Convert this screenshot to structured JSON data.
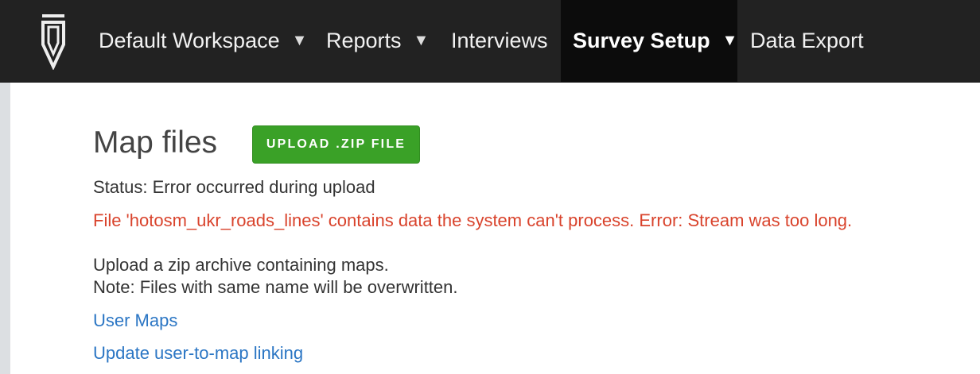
{
  "nav": {
    "items": [
      {
        "label": "Default Workspace",
        "dropdown": true
      },
      {
        "label": "Reports",
        "dropdown": true
      },
      {
        "label": "Interviews",
        "dropdown": false
      },
      {
        "label": "Survey Setup",
        "dropdown": true,
        "active": true
      },
      {
        "label": "Data Export",
        "dropdown": false
      }
    ],
    "caret": "▼"
  },
  "page": {
    "title": "Map files",
    "upload_button": "UPLOAD .ZIP FILE",
    "status": "Status: Error occurred during upload",
    "error": "File 'hotosm_ukr_roads_lines' contains data the system can't process. Error: Stream was too long.",
    "note_line1": "Upload a zip archive containing maps.",
    "note_line2": "Note: Files with same name will be overwritten.",
    "links": [
      "User Maps",
      "Update user-to-map linking"
    ]
  },
  "colors": {
    "navbar_bg": "#222222",
    "active_bg": "#0c0c0c",
    "button_green": "#3aa127",
    "error_red": "#d9432c",
    "link_blue": "#2b76c4"
  }
}
